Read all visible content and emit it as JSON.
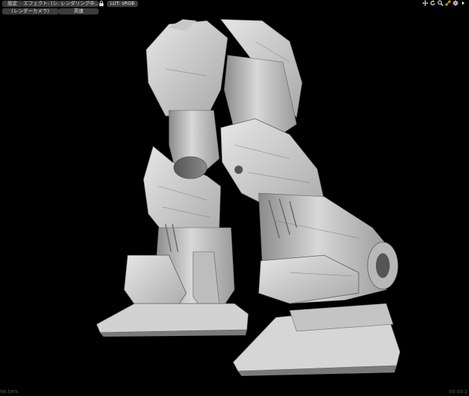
{
  "toolbar": {
    "settings_label": "設定",
    "effect_label": "エフェクト: (シ...",
    "rendering_label": "レンダリング中...",
    "lut_label": "LUT: sRGB",
    "camera_label": "(レンダーカメラ)",
    "quality_label": "高速"
  },
  "icons": {
    "lock": "lock-icon",
    "move": "move-icon",
    "rotate": "rotate-icon",
    "zoom": "zoom-icon",
    "fit": "fit-icon",
    "gear": "gear-icon",
    "more": "play-arrow-icon",
    "accent": "#f2b600"
  },
  "status": {
    "zoom": "96.58%",
    "time": "00:00:2"
  }
}
